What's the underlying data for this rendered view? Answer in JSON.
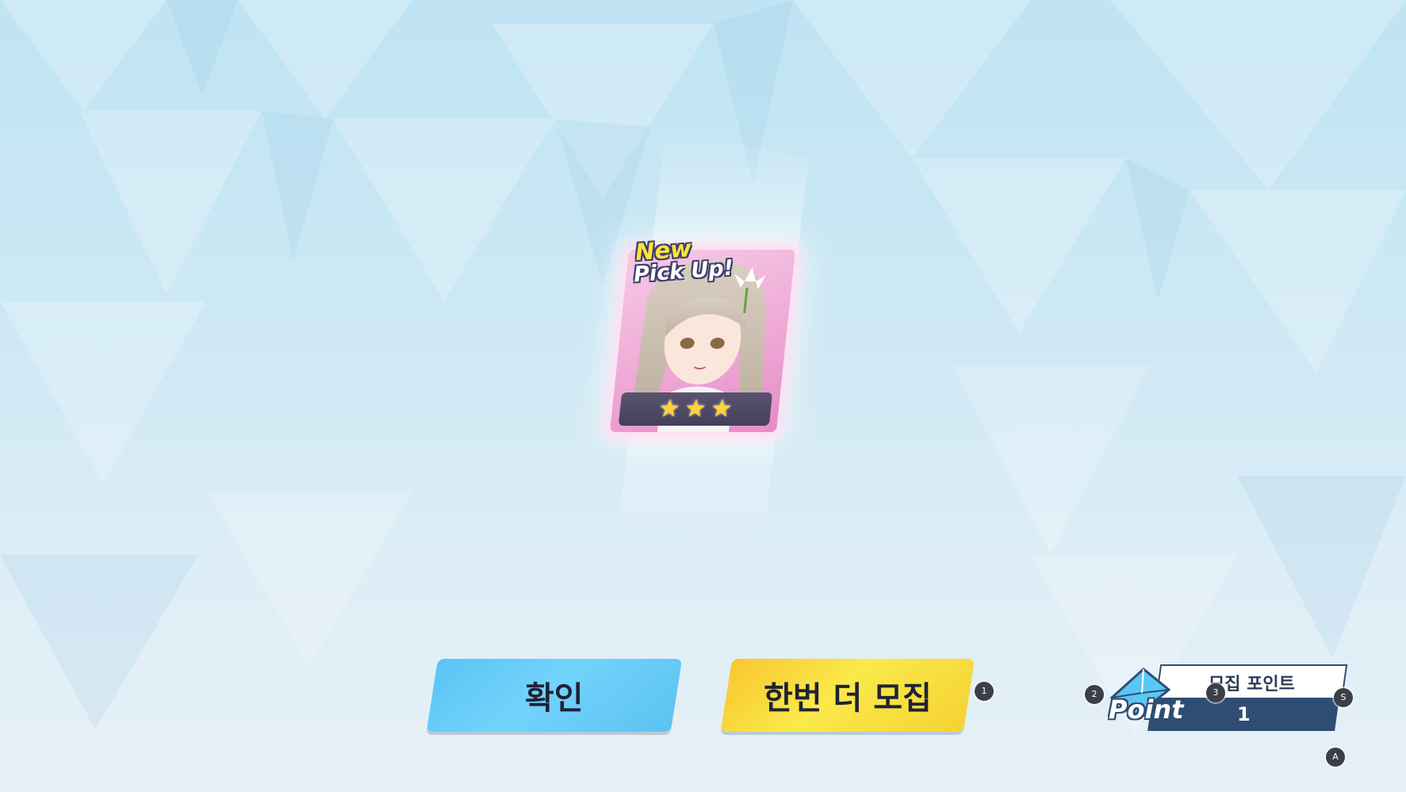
{
  "card": {
    "badge_line1": "New",
    "badge_line2": "Pick Up!",
    "rarity_stars": 3
  },
  "buttons": {
    "confirm_label": "확인",
    "recruit_again_label": "한번 더 모집"
  },
  "recruit_points": {
    "label": "모집 포인트",
    "icon_word": "Point",
    "value": "1"
  },
  "key_hints": {
    "recruit_again": "1",
    "points_left": "2",
    "points_mid": "3",
    "points_right": "S",
    "bottom": "A"
  },
  "colors": {
    "confirm_button": "#5ac4f4",
    "recruit_button": "#f7d83a",
    "points_navy": "#2f4d72",
    "card_pink": "#eeaad6"
  }
}
